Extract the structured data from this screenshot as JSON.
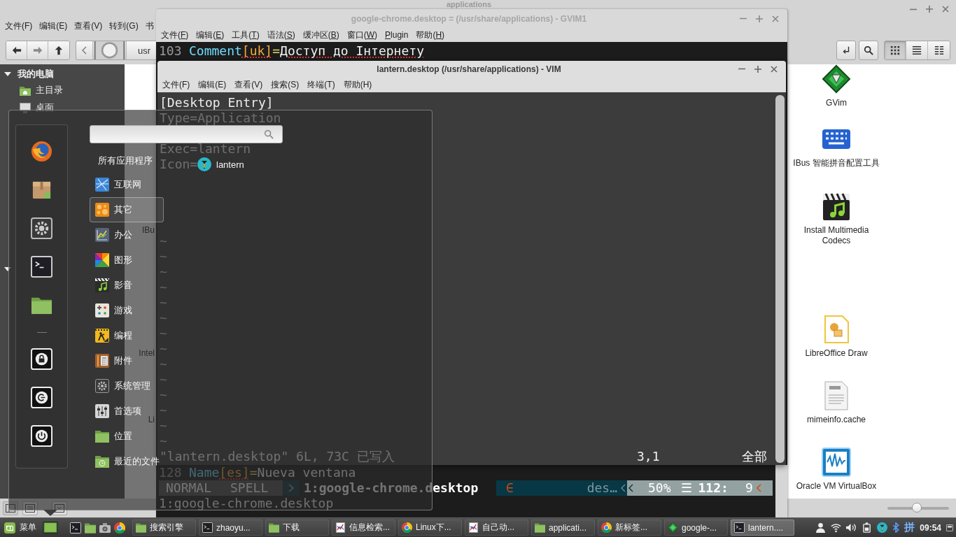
{
  "file_manager": {
    "title": "applications",
    "active": false,
    "menu": [
      "文件(F)",
      "编辑(E)",
      "查看(V)",
      "转到(G)",
      "书"
    ],
    "path": [
      "usr"
    ],
    "view_modes": [
      {
        "selected": true
      },
      {
        "selected": false
      },
      {
        "selected": false
      }
    ],
    "sidebar": [
      {
        "title": "我的电脑",
        "expanded": true,
        "items": [
          "主目录",
          "桌面"
        ]
      },
      {
        "expanded": true
      }
    ],
    "file_rows": [
      {
        "right": "GVim"
      },
      {
        "right": "IBus 智能拼音配置工具"
      },
      {
        "left": "IBu",
        "right": "Install Multimedia Codecs"
      },
      {
        "left": "Intel",
        "right": "LibreOffice Draw"
      },
      {
        "left": "Li",
        "right": "mimeinfo.cache"
      },
      {
        "right": "Oracle VM VirtualBox"
      }
    ],
    "zoom_slider": {
      "level": 0.48
    }
  },
  "gvim": {
    "title": "google-chrome.desktop = (/usr/share/applications) - GVIM1",
    "active": false,
    "menu": [
      {
        "before": "文件(",
        "key": "F",
        "after": ")"
      },
      {
        "before": "编辑(",
        "key": "E",
        "after": ")"
      },
      {
        "before": "工具(",
        "key": "T",
        "after": ")"
      },
      {
        "before": "语法(",
        "key": "S",
        "after": ")"
      },
      {
        "before": "缓冲区(",
        "key": "B",
        "after": ")"
      },
      {
        "before": "窗口(",
        "key": "W",
        "after": ")"
      },
      {
        "key": "P",
        "after": "lugin"
      },
      {
        "before": "帮助(",
        "key": "H",
        "after": ")"
      }
    ],
    "top_line": {
      "number": "103",
      "parts": [
        {
          "kind": "key",
          "text": "Comment",
          "spell_error": false
        },
        {
          "kind": "locale",
          "text": "[uk]",
          "spell_error": true
        },
        {
          "kind": "sign",
          "text": "=",
          "spell_error": false
        },
        {
          "kind": "value",
          "text": "Доступ до Інтернету",
          "spell_error": true
        }
      ]
    },
    "bottom_line": {
      "number": "128",
      "parts": [
        {
          "kind": "key",
          "text": "Name",
          "spell_error": false
        },
        {
          "kind": "locale",
          "text": "[es]",
          "spell_error": true
        },
        {
          "kind": "sign",
          "text": "=",
          "spell_error": false
        },
        {
          "kind": "value",
          "text": "Nueva ventana",
          "spell_error": false
        }
      ]
    },
    "statusline": {
      "mode": "NORMAL",
      "spell": "SPELL",
      "buffer": "1:google-chrome.desktop",
      "format": "∈",
      "file": "des…",
      "percent": "50%",
      "lines_symbol": "☰",
      "line": "112:",
      "column": "9"
    },
    "command_line": "1:google-chrome.desktop"
  },
  "vim": {
    "title": "lantern.desktop (/usr/share/applications) - VIM",
    "active": true,
    "menu": [
      "文件(F)",
      "编辑(E)",
      "查看(V)",
      "搜索(S)",
      "终端(T)",
      "帮助(H)"
    ],
    "lines": [
      "[Desktop Entry]",
      "Type=Application",
      "Exec=lantern",
      "Icon="
    ],
    "filler": [
      "~",
      "~",
      "~",
      "~",
      "~",
      "~",
      "~",
      "~",
      "~",
      "~",
      "~",
      "~",
      "~",
      "~"
    ],
    "message": "\"lantern.desktop\" 6L, 73C 已写入",
    "ruler": "3,1",
    "position": "全部"
  },
  "menu": {
    "categories": [
      {
        "label": "所有应用程序",
        "kind": "all",
        "selected": false
      },
      {
        "label": "互联网",
        "kind": "category",
        "selected": false
      },
      {
        "label": "其它",
        "kind": "category",
        "selected": true
      },
      {
        "label": "办公",
        "kind": "category",
        "selected": false
      },
      {
        "label": "图形",
        "kind": "category",
        "selected": false
      },
      {
        "label": "影音",
        "kind": "category",
        "selected": false
      },
      {
        "label": "游戏",
        "kind": "category",
        "selected": false
      },
      {
        "label": "编程",
        "kind": "category",
        "selected": false
      },
      {
        "label": "附件",
        "kind": "category",
        "selected": false
      },
      {
        "label": "系统管理",
        "kind": "category",
        "selected": false
      },
      {
        "label": "首选项",
        "kind": "category",
        "selected": false
      },
      {
        "label": "位置",
        "kind": "category",
        "selected": false
      },
      {
        "label": "最近的文件",
        "kind": "category",
        "selected": false
      }
    ],
    "apps": [
      {
        "label": "lantern"
      }
    ]
  },
  "taskbar": {
    "menu_label": "菜单",
    "windows": [
      {
        "label": "搜索引擎",
        "selected": false
      },
      {
        "label": "zhaoyu...",
        "selected": false
      },
      {
        "label": "下载",
        "selected": false
      },
      {
        "label": "信息检索...",
        "selected": false
      },
      {
        "label": "Linux下...",
        "selected": false
      },
      {
        "label": "自己动...",
        "selected": false
      },
      {
        "label": "applicati...",
        "selected": false
      },
      {
        "label": "新标签...",
        "selected": false
      },
      {
        "label": "google-...",
        "selected": false
      },
      {
        "label": "lantern....",
        "selected": true
      }
    ],
    "input_method": "拼",
    "clock": "09:54"
  }
}
